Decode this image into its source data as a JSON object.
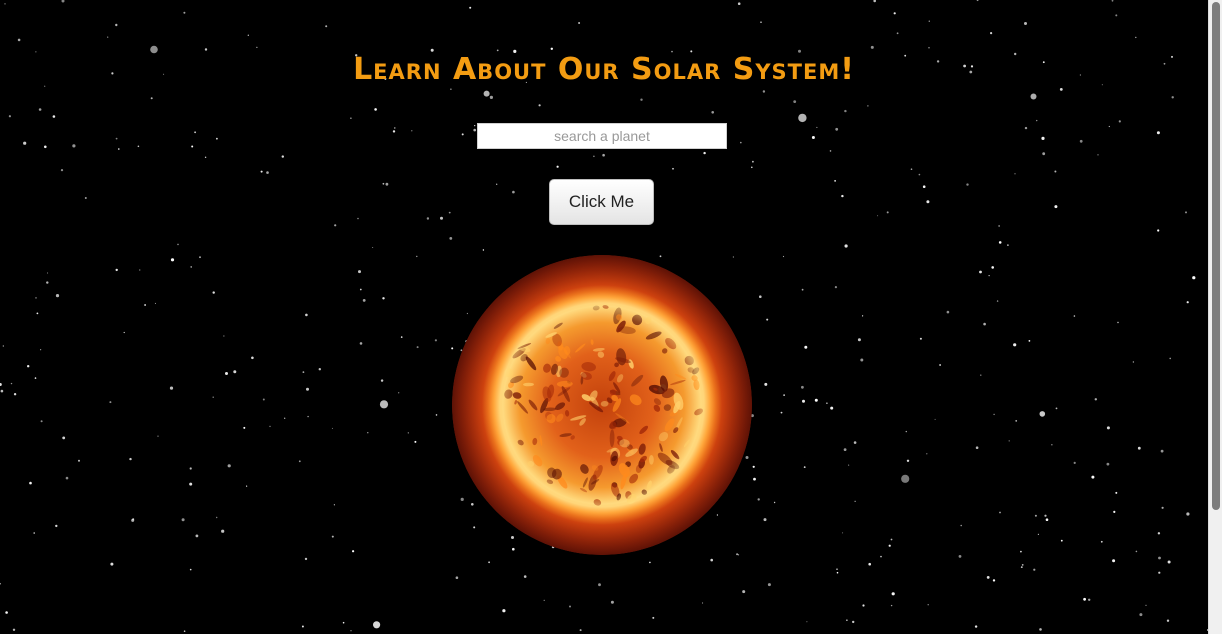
{
  "page": {
    "title": "Learn About Our Solar System!"
  },
  "search": {
    "placeholder": "search a planet",
    "value": ""
  },
  "button": {
    "label": "Click Me"
  },
  "image": {
    "subject": "sun"
  },
  "colors": {
    "background": "#000000",
    "title": "#f39c12",
    "sun_core": "#ffd36b",
    "sun_mid": "#f0621a",
    "sun_edge": "#7a1a08"
  }
}
